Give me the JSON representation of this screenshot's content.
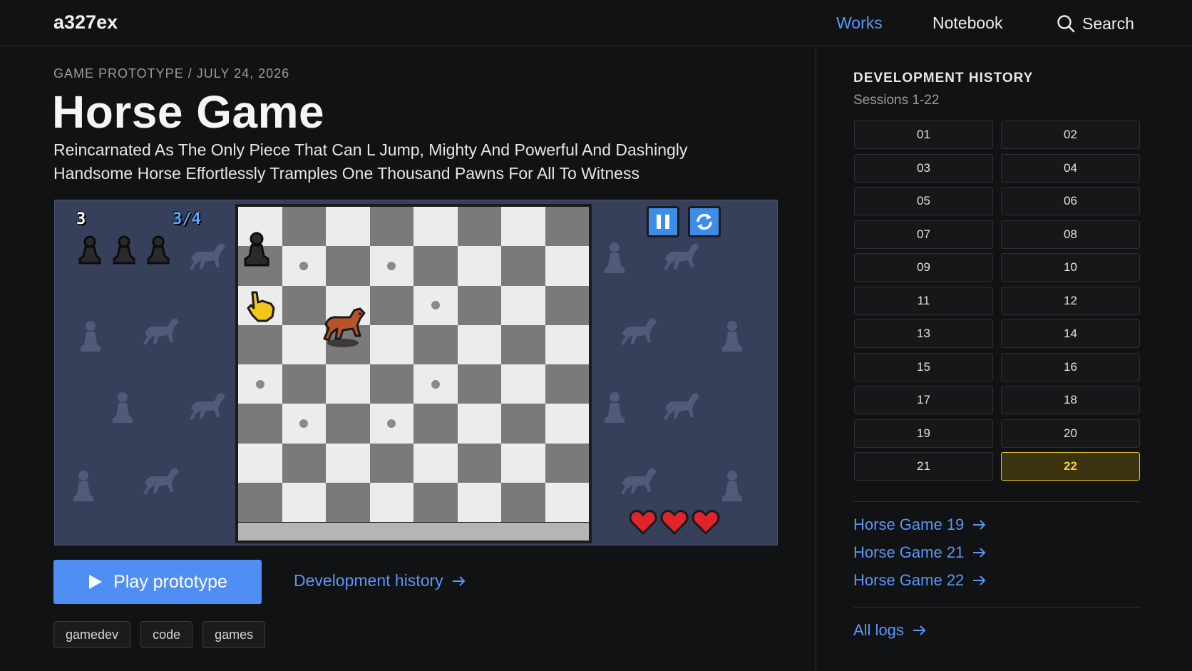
{
  "site": {
    "logo": "a327ex"
  },
  "nav": {
    "works": "Works",
    "notebook": "Notebook",
    "search": "Search"
  },
  "colors": {
    "accent": "#5b96f7",
    "active_session": "#e6c029",
    "background": "#111213"
  },
  "article": {
    "meta": "GAME PROTOTYPE / JULY 24, 2026",
    "title": "Horse Game",
    "subtitle": "Reincarnated As The Only Piece That Can L Jump, Mighty And Powerful And Dashingly Handsome Horse Effortlessly Tramples One Thousand Pawns For All To Witness"
  },
  "game": {
    "score": "3",
    "moves": "3/4",
    "pawns_remaining": 3,
    "hearts": 3,
    "pause_icon": "pause-icon",
    "restart_icon": "restart-icon"
  },
  "actions": {
    "play_label": "Play prototype",
    "dev_history_label": "Development history"
  },
  "tags": [
    "gamedev",
    "code",
    "games"
  ],
  "sidebar": {
    "title": "DEVELOPMENT HISTORY",
    "subtitle": "Sessions 1-22",
    "sessions": [
      "01",
      "02",
      "03",
      "04",
      "05",
      "06",
      "07",
      "08",
      "09",
      "10",
      "11",
      "12",
      "13",
      "14",
      "15",
      "16",
      "17",
      "18",
      "19",
      "20",
      "21",
      "22"
    ],
    "active_session": "22",
    "related": [
      "Horse Game 19",
      "Horse Game 21",
      "Horse Game 22"
    ],
    "all_logs": "All logs"
  }
}
